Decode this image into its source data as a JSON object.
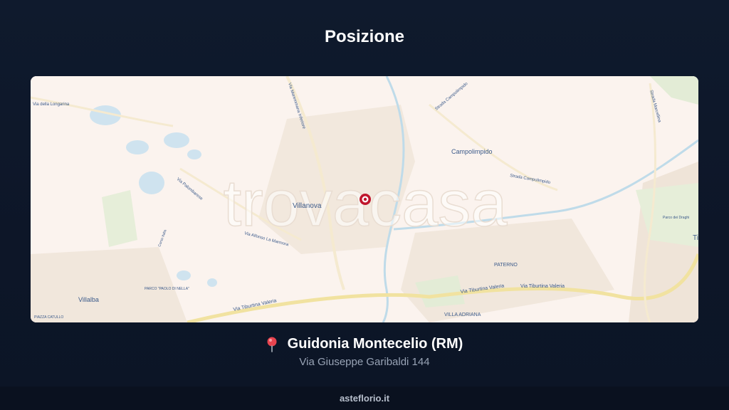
{
  "header": {
    "title": "Posizione"
  },
  "map": {
    "watermark": "trovacasa",
    "labels": {
      "villanova": "Villanova",
      "campolimpido": "Campolimpido",
      "paterno": "PATERNO",
      "villa_adriana": "VILLA ADRIANA",
      "villalba": "Villalba",
      "parco": "PARCO \"PAOLO DI NELLA\"",
      "piazza": "PIAZZA CATULLO",
      "tiburtina_1": "Via Tiburtina Valeria",
      "tiburtina_2": "Via Tiburtina Valeria",
      "tiburtina_3": "Via Tiburtina Valeria",
      "longarina": "Via della Longarina",
      "nomentana_1": "Via Palombarese",
      "nomentana_2": "Via Maremmana Inferiore",
      "strada_campolimpido": "Strada Campolimpido",
      "strada_campolimpido_2": "Strada Campolimpido",
      "marcellina": "Strada Marcellina",
      "lamarmora": "Via Alfonso La Marmora",
      "corso": "Corso Italia",
      "tivoli": "Ti",
      "parco_sud": "Parco dei Draghi"
    },
    "marker_icon": "location-marker-icon"
  },
  "location": {
    "icon": "pin-icon",
    "name": "Guidonia Montecelio (RM)",
    "address": "Via Giuseppe Garibaldi 144"
  },
  "footer": {
    "site": "asteflorio.it"
  }
}
